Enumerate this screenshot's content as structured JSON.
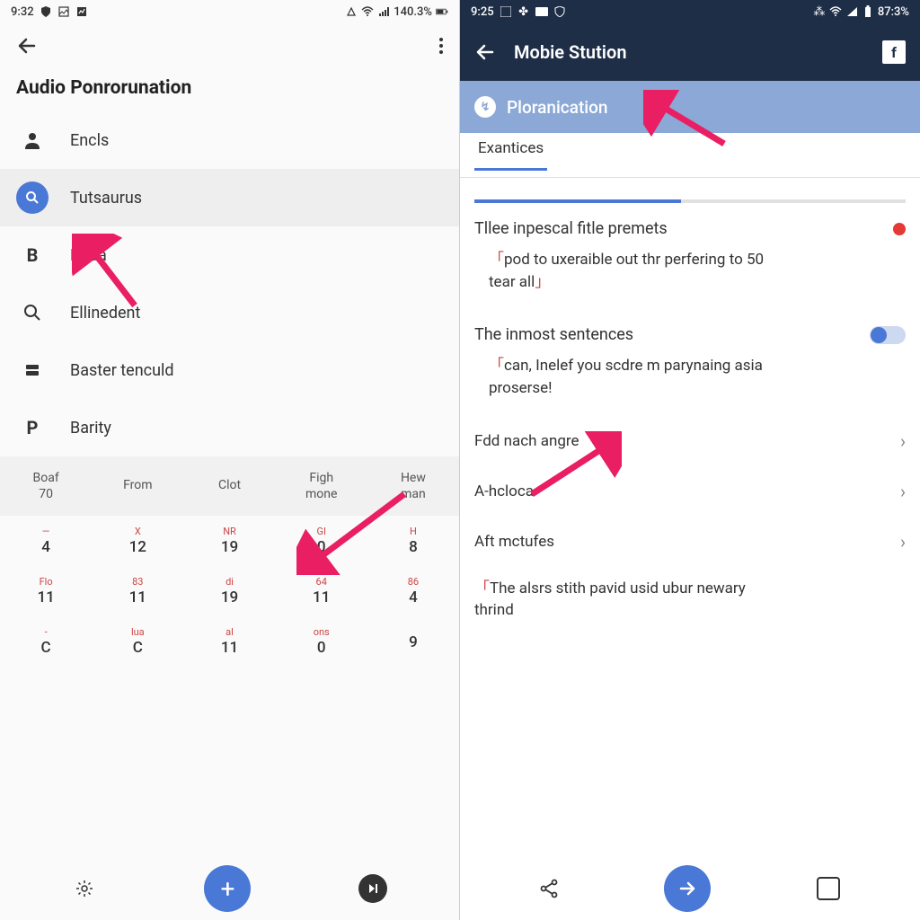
{
  "left": {
    "status": {
      "time": "9:32",
      "battery": "140.3%"
    },
    "title": "Audio Ponrorunation",
    "menu": [
      {
        "icon": "person",
        "label": "Encls"
      },
      {
        "icon": "search-blue",
        "label": "Tutsaurus",
        "selected": true
      },
      {
        "icon": "B",
        "label": "Rada"
      },
      {
        "icon": "search",
        "label": "Ellinedent"
      },
      {
        "icon": "list",
        "label": "Baster tenculd"
      },
      {
        "icon": "P",
        "label": "Barity"
      }
    ],
    "table": {
      "headers": [
        {
          "top": "Boaf",
          "bottom": "70"
        },
        {
          "top": "From",
          "bottom": ""
        },
        {
          "top": "Clot",
          "bottom": ""
        },
        {
          "top": "Figh",
          "bottom": "mone"
        },
        {
          "top": "Hew",
          "bottom": "man"
        }
      ],
      "rows": [
        [
          {
            "t": "—",
            "b": "4"
          },
          {
            "t": "X",
            "b": "12"
          },
          {
            "t": "NR",
            "b": "19"
          },
          {
            "t": "GI",
            "b": "0"
          },
          {
            "t": "H",
            "b": "8"
          }
        ],
        [
          {
            "t": "Flo",
            "b": "11"
          },
          {
            "t": "83",
            "b": "11"
          },
          {
            "t": "di",
            "b": "19"
          },
          {
            "t": "64",
            "b": "11"
          },
          {
            "t": "86",
            "b": "4"
          }
        ],
        [
          {
            "t": "-",
            "b": "C"
          },
          {
            "t": "lua",
            "b": "C"
          },
          {
            "t": "al",
            "b": "11"
          },
          {
            "t": "ons",
            "b": "0"
          },
          {
            "t": "",
            "b": "9"
          }
        ]
      ]
    }
  },
  "right": {
    "status": {
      "time": "9:25",
      "battery": "87:3%"
    },
    "header": "Mobie Stution",
    "subheader": "Ploranication",
    "tab": "Exantices",
    "sec1_title": "Tllee inpescal fitle premets",
    "sec1_sentence_a": "pod to uxeraible out thr perfering to 50 ",
    "sec1_sentence_b": "tear all",
    "sec2_title": "The inmost sentences",
    "sec2_sentence_a": "can, Inelef you scdre m parynaing asia ",
    "sec2_sentence_b": "proserse!",
    "settings": [
      "Fdd nach angre",
      "A-hcloca",
      "Aft mctufes"
    ],
    "footer_a": "The alsrs stith pavid usid ubur newary ",
    "footer_b": "thrind"
  }
}
